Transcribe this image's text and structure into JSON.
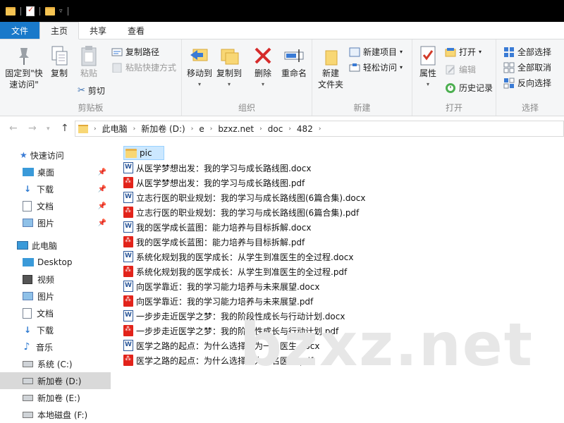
{
  "tabs": {
    "file": "文件",
    "home": "主页",
    "share": "共享",
    "view": "查看"
  },
  "ribbon": {
    "clipboard": {
      "label": "剪贴板",
      "pin_quick": "固定到\"快\n速访问\"",
      "copy": "复制",
      "paste": "粘贴",
      "copy_path": "复制路径",
      "paste_shortcut": "粘贴快捷方式",
      "cut": "剪切"
    },
    "organize": {
      "label": "组织",
      "move_to": "移动到",
      "copy_to": "复制到",
      "delete": "删除",
      "rename": "重命名"
    },
    "new": {
      "label": "新建",
      "new_folder": "新建\n文件夹",
      "new_item": "新建项目",
      "easy_access": "轻松访问"
    },
    "open": {
      "label": "打开",
      "properties": "属性",
      "open": "打开",
      "edit": "编辑",
      "history": "历史记录"
    },
    "select": {
      "label": "选择",
      "select_all": "全部选择",
      "select_none": "全部取消",
      "invert": "反向选择"
    }
  },
  "address": {
    "crumbs": [
      "此电脑",
      "新加卷 (D:)",
      "e",
      "bzxz.net",
      "doc",
      "482"
    ]
  },
  "nav": {
    "quick_access": "快速访问",
    "qa_items": [
      "桌面",
      "下载",
      "文档",
      "图片"
    ],
    "this_pc": "此电脑",
    "pc_items": [
      "Desktop",
      "视频",
      "图片",
      "文档",
      "下载",
      "音乐",
      "系统 (C:)",
      "新加卷 (D:)",
      "新加卷 (E:)",
      "本地磁盘 (F:)"
    ]
  },
  "files": [
    {
      "name": "pic",
      "type": "folder"
    },
    {
      "name": "从医学梦想出发：我的学习与成长路线图.docx",
      "type": "docx"
    },
    {
      "name": "从医学梦想出发：我的学习与成长路线图.pdf",
      "type": "pdf"
    },
    {
      "name": "立志行医的职业规划：我的学习与成长路线图(6篇合集).docx",
      "type": "docx"
    },
    {
      "name": "立志行医的职业规划：我的学习与成长路线图(6篇合集).pdf",
      "type": "pdf"
    },
    {
      "name": "我的医学成长蓝图：能力培养与目标拆解.docx",
      "type": "docx"
    },
    {
      "name": "我的医学成长蓝图：能力培养与目标拆解.pdf",
      "type": "pdf"
    },
    {
      "name": "系统化规划我的医学成长：从学生到准医生的全过程.docx",
      "type": "docx"
    },
    {
      "name": "系统化规划我的医学成长：从学生到准医生的全过程.pdf",
      "type": "pdf"
    },
    {
      "name": "向医学靠近：我的学习能力培养与未来展望.docx",
      "type": "docx"
    },
    {
      "name": "向医学靠近：我的学习能力培养与未来展望.pdf",
      "type": "pdf"
    },
    {
      "name": "一步步走近医学之梦：我的阶段性成长与行动计划.docx",
      "type": "docx"
    },
    {
      "name": "一步步走近医学之梦：我的阶段性成长与行动计划.pdf",
      "type": "pdf"
    },
    {
      "name": "医学之路的起点：为什么选择成为一名医生.docx",
      "type": "docx"
    },
    {
      "name": "医学之路的起点：为什么选择成为一名医生.pdf",
      "type": "pdf"
    }
  ],
  "watermark": "bzxz.net",
  "colors": {
    "file_tab": "#1979ca",
    "selection": "#cce8ff",
    "folder": "#f8d775",
    "pdf": "#e2231a",
    "docx": "#2b579a"
  }
}
